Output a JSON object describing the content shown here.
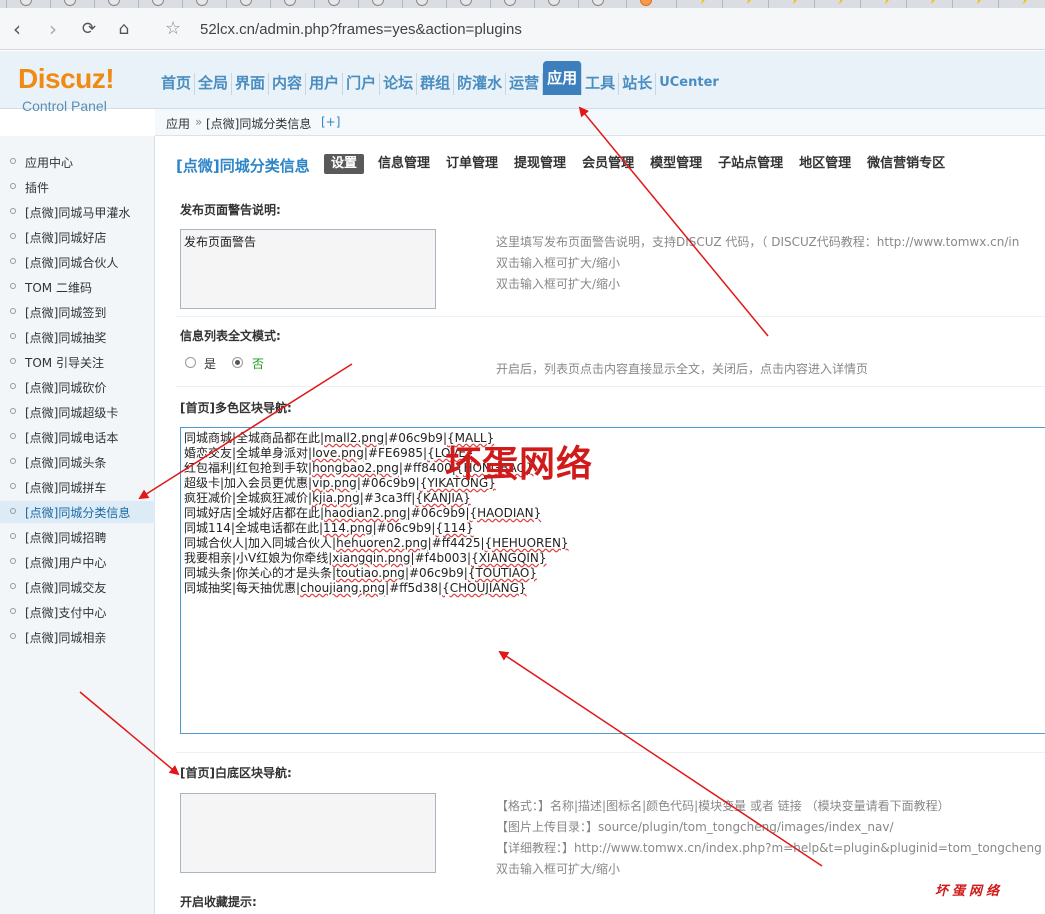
{
  "browser": {
    "url": "52lcx.cn/admin.php?frames=yes&action=plugins",
    "back_icon": "arrow-left-icon",
    "forward_icon": "arrow-right-icon",
    "reload_icon": "reload-icon",
    "home_icon": "home-icon",
    "star_icon": "star-icon"
  },
  "logo": {
    "line1": "Discuz!",
    "line2": "Control Panel"
  },
  "topnav": [
    "首页",
    "全局",
    "界面",
    "内容",
    "用户",
    "门户",
    "论坛",
    "群组",
    "防灌水",
    "运营",
    "应用",
    "工具",
    "站长",
    "UCenter"
  ],
  "topnav_active": "应用",
  "breadcrumb": {
    "root": "应用",
    "sep": "»",
    "current": "[点微]同城分类信息",
    "add": "[+]"
  },
  "sidebar": {
    "items": [
      "应用中心",
      "插件",
      "[点微]同城马甲灌水",
      "[点微]同城好店",
      "[点微]同城合伙人",
      "TOM 二维码",
      "[点微]同城签到",
      "[点微]同城抽奖",
      "TOM 引导关注",
      "[点微]同城砍价",
      "[点微]同城超级卡",
      "[点微]同城电话本",
      "[点微]同城头条",
      "[点微]同城拼车",
      "[点微]同城分类信息",
      "[点微]同城招聘",
      "[点微]用户中心",
      "[点微]同城交友",
      "[点微]支付中心",
      "[点微]同城相亲"
    ],
    "active": "[点微]同城分类信息"
  },
  "plugin": {
    "title": "[点微]同城分类信息",
    "tabs": [
      "设置",
      "信息管理",
      "订单管理",
      "提现管理",
      "会员管理",
      "模型管理",
      "子站点管理",
      "地区管理",
      "微信营销专区"
    ],
    "active_tab": "设置"
  },
  "sections": {
    "warn": {
      "label": "发布页面警告说明:",
      "value": "发布页面警告",
      "tip1": "这里填写发布页面警告说明，支持DISCUZ 代码，（ DISCUZ代码教程：http://www.tomwx.cn/in",
      "tip2": "双击输入框可扩大/缩小",
      "tip3": "双击输入框可扩大/缩小"
    },
    "fulltext": {
      "label": "信息列表全文模式:",
      "yes": "是",
      "no": "否",
      "selected": "否",
      "tip": "开启后，列表页点击内容直接显示全文，关闭后，点击内容进入详情页"
    },
    "colornav": {
      "label": "[首页]多色区块导航:",
      "lines": [
        [
          "同城商城|全城商品都在此|",
          "mall2.png",
          "|#06c9b9|",
          "{MALL}"
        ],
        [
          "婚恋交友|全城单身派对|",
          "love.png",
          "|#FE6985|",
          "{LOVE}"
        ],
        [
          "红包福利|红包抢到手软|",
          "hongbao2.png",
          "|#ff8400|",
          "{HONGBAO}"
        ],
        [
          "超级卡|加入会员更优惠|",
          "vip.png",
          "|#06c9b9|",
          "{YIKATONG}"
        ],
        [
          "疯狂减价|全城疯狂减价|",
          "kjia.png",
          "|#3ca3ff|",
          "{KANJIA}"
        ],
        [
          "同城好店|全城好店都在此|",
          "haodian2.png",
          "|#06c9b9|",
          "{HAODIAN}"
        ],
        [
          "同城114|全城电话都在此|",
          "114.png",
          "|#06c9b9|",
          "{114}"
        ],
        [
          "同城合伙人|加入同城合伙人|",
          "hehuoren2.png",
          "|#ff4425|",
          "{HEHUOREN}"
        ],
        [
          "我要相亲|小V红娘为你牵线|",
          "xiangqin.png",
          "|#f4b003|",
          "{XIANGQIN}"
        ],
        [
          "同城头条|你关心的才是头条|",
          "toutiao.png",
          "|#06c9b9|",
          "{TOUTIAO}"
        ],
        [
          "同城抽奖|每天抽优惠|",
          "choujiang.png",
          "|#ff5d38|",
          "{CHOUJIANG}"
        ]
      ]
    },
    "whitenav": {
      "label": "[首页]白底区块导航:",
      "value": "",
      "tip1": "【格式：】名称|描述|图标名|颜色代码|模块变量 或者 链接 （模块变量请看下面教程）",
      "tip2": "【图片上传目录：】source/plugin/tom_tongcheng/images/index_nav/",
      "tip3": "【详细教程：】http://www.tomwx.cn/index.php?m=help&t=plugin&pluginid=tom_tongcheng",
      "tip4": "双击输入框可扩大/缩小"
    },
    "favorite": {
      "label": "开启收藏提示:"
    }
  },
  "watermark": {
    "big": "坏蛋网络",
    "small": "坏蛋网络"
  },
  "colors": {
    "accent": "#2e86c8",
    "nav": "#4a8ec1",
    "active_nav": "#3d7fbd",
    "logo": "#f08a12",
    "arrow": "#e01818"
  }
}
